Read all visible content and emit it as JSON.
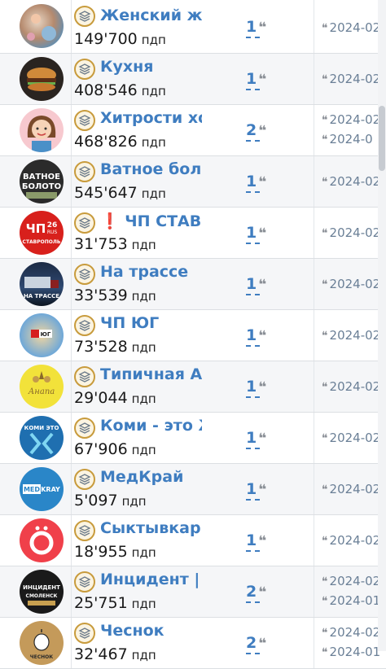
{
  "channels": [
    {
      "name": "Женский жур",
      "subs": "149'700",
      "unit": "пдп",
      "count": "1",
      "dates": [
        "2024-02"
      ]
    },
    {
      "name": "Кухня",
      "subs": "408'546",
      "unit": "пдп",
      "count": "1",
      "dates": [
        "2024-02"
      ]
    },
    {
      "name": "Хитрости хоз",
      "subs": "468'826",
      "unit": "пдп",
      "count": "2",
      "dates": [
        "2024-02",
        "2024-0"
      ]
    },
    {
      "name": "Ватное болот",
      "subs": "545'647",
      "unit": "пдп",
      "count": "1",
      "dates": [
        "2024-02"
      ]
    },
    {
      "name": "❗ ЧП СТАВРС",
      "subs": "31'753",
      "unit": "пдп",
      "count": "1",
      "dates": [
        "2024-02"
      ]
    },
    {
      "name": "На трассе",
      "subs": "33'539",
      "unit": "пдп",
      "count": "1",
      "dates": [
        "2024-02"
      ]
    },
    {
      "name": "ЧП ЮГ",
      "subs": "73'528",
      "unit": "пдп",
      "count": "1",
      "dates": [
        "2024-02"
      ]
    },
    {
      "name": "Типичная Ана",
      "subs": "29'044",
      "unit": "пдп",
      "count": "1",
      "dates": [
        "2024-02"
      ]
    },
    {
      "name": "Коми - это Ж",
      "subs": "67'906",
      "unit": "пдп",
      "count": "1",
      "dates": [
        "2024-02"
      ]
    },
    {
      "name": "МедКрай",
      "subs": "5'097",
      "unit": "пдп",
      "count": "1",
      "dates": [
        "2024-02"
      ]
    },
    {
      "name": "Сыктывкар О",
      "subs": "18'955",
      "unit": "пдп",
      "count": "1",
      "dates": [
        "2024-02"
      ]
    },
    {
      "name": "Инцидент | Сі",
      "subs": "25'751",
      "unit": "пдп",
      "count": "2",
      "dates": [
        "2024-02",
        "2024-01"
      ]
    },
    {
      "name": "Чеснок",
      "subs": "32'467",
      "unit": "пдп",
      "count": "2",
      "dates": [
        "2024-02",
        "2024-01"
      ]
    }
  ],
  "avatar_labels": {
    "vatnoe": [
      "ВАТНОЕ",
      "БОЛОТО"
    ],
    "chp_stav": [
      "ЧП",
      "26",
      "RUS",
      "СТАВРОПОЛЬ"
    ],
    "trassa": "НА ТРАССЕ",
    "chp_yug": "ЮГ",
    "anapa": "Анапа",
    "komi": "КОМИ ЭТО",
    "medkray": [
      "MED",
      "KRAY"
    ],
    "incident": [
      "ИНЦИДЕНТ",
      "СМОЛЕНСК"
    ],
    "chesnok": "ЧЕСНОК"
  },
  "icons": {
    "badge": "stack-layers-icon",
    "quote": "quote-mark-icon"
  },
  "colors": {
    "link": "#3f7dc0",
    "badge_border": "#c89b3c",
    "date": "#6a7f96",
    "row_alt": "#f5f6f8"
  }
}
